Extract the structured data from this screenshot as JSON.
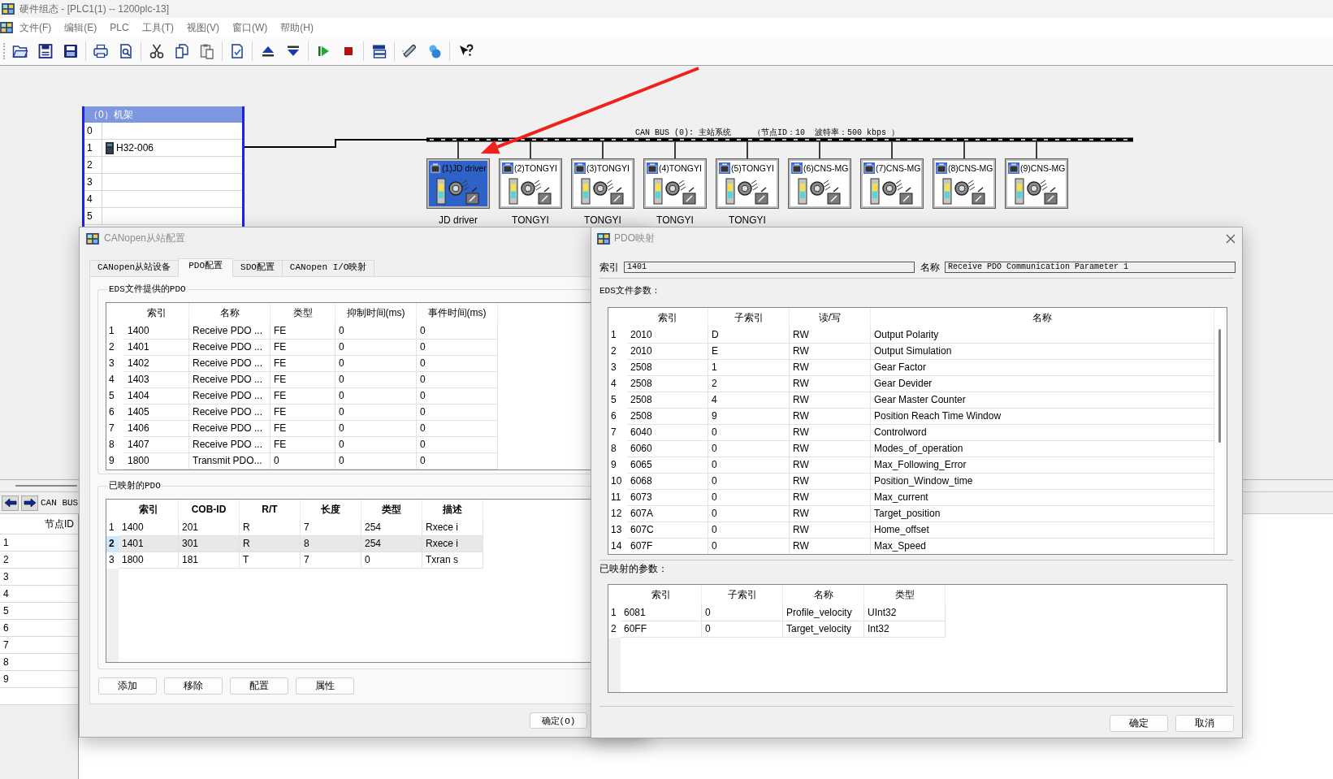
{
  "window": {
    "title": "硬件组态 - [PLC1(1) -- 1200plc-13]"
  },
  "menu": [
    "文件(F)",
    "编辑(E)",
    "PLC",
    "工具(T)",
    "视图(V)",
    "窗口(W)",
    "帮助(H)"
  ],
  "rack": {
    "title": "（0）机架",
    "slots": [
      {
        "slot": "0"
      },
      {
        "slot": "1",
        "module": "H32-006"
      },
      {
        "slot": "2"
      },
      {
        "slot": "3"
      },
      {
        "slot": "4"
      },
      {
        "slot": "5"
      }
    ]
  },
  "bus": {
    "label": "CAN BUS (0): 主站系统",
    "info": "（节点ID：10  波特率：500 kbps ）",
    "nodes": [
      {
        "title": "(1)JD driver",
        "caption": "JD driver",
        "selected": true
      },
      {
        "title": "(2)TONGYI",
        "caption": "TONGYI",
        "selected": false
      },
      {
        "title": "(3)TONGYI",
        "caption": "TONGYI",
        "selected": false
      },
      {
        "title": "(4)TONGYI",
        "caption": "TONGYI",
        "selected": false
      },
      {
        "title": "(5)TONGYI",
        "caption": "TONGYI",
        "selected": false
      },
      {
        "title": "(6)CNS-MG",
        "selected": false
      },
      {
        "title": "(7)CNS-MG",
        "selected": false
      },
      {
        "title": "(8)CNS-MG",
        "selected": false
      },
      {
        "title": "(9)CNS-MG",
        "selected": false
      }
    ]
  },
  "bus_panel": {
    "title": "CAN BUS",
    "column": "节点ID",
    "rows": [
      "1",
      "2",
      "3",
      "4",
      "5",
      "6",
      "7",
      "8",
      "9"
    ]
  },
  "slave_dialog": {
    "title": "CANopen从站配置",
    "tabs": [
      {
        "label": "CANopen从站设备",
        "selected": false
      },
      {
        "label": "PDO配置",
        "selected": true
      },
      {
        "label": "SDO配置",
        "selected": false
      },
      {
        "label": "CANopen I/O映射",
        "selected": false
      }
    ],
    "eds_group": "EDS文件提供的PDO",
    "eds_table": {
      "columns": [
        "索引",
        "名称",
        "类型",
        "抑制时间(ms)",
        "事件时间(ms)"
      ],
      "rows": [
        {
          "num": "1",
          "cells": [
            "1400",
            "Receive PDO ...",
            "FE",
            "0",
            "0"
          ],
          "selected": false
        },
        {
          "num": "2",
          "cells": [
            "1401",
            "Receive PDO ...",
            "FE",
            "0",
            "0"
          ],
          "selected": false
        },
        {
          "num": "3",
          "cells": [
            "1402",
            "Receive PDO ...",
            "FE",
            "0",
            "0"
          ],
          "selected": false
        },
        {
          "num": "4",
          "cells": [
            "1403",
            "Receive PDO ...",
            "FE",
            "0",
            "0"
          ],
          "selected": false
        },
        {
          "num": "5",
          "cells": [
            "1404",
            "Receive PDO ...",
            "FE",
            "0",
            "0"
          ],
          "selected": false
        },
        {
          "num": "6",
          "cells": [
            "1405",
            "Receive PDO ...",
            "FE",
            "0",
            "0"
          ],
          "selected": false
        },
        {
          "num": "7",
          "cells": [
            "1406",
            "Receive PDO ...",
            "FE",
            "0",
            "0"
          ],
          "selected": false
        },
        {
          "num": "8",
          "cells": [
            "1407",
            "Receive PDO ...",
            "FE",
            "0",
            "0"
          ],
          "selected": false
        },
        {
          "num": "9",
          "cells": [
            "1800",
            "Transmit PDO...",
            "0",
            "0",
            "0"
          ],
          "selected": false
        }
      ]
    },
    "mapped_group": "已映射的PDO",
    "mapped_table": {
      "columns": [
        "索引",
        "COB-ID",
        "R/T",
        "长度",
        "类型",
        "描述"
      ],
      "rows": [
        {
          "num": "1",
          "cells": [
            "1400",
            "201",
            "R",
            "7",
            "254",
            "Rxece i"
          ],
          "selected": false
        },
        {
          "num": "2",
          "cells": [
            "1401",
            "301",
            "R",
            "8",
            "254",
            "Rxece i"
          ],
          "selected": true
        },
        {
          "num": "3",
          "cells": [
            "1800",
            "181",
            "T",
            "7",
            "0",
            "Txran s"
          ],
          "selected": false
        }
      ]
    },
    "buttons": [
      "添加",
      "移除",
      "配置",
      "属性"
    ],
    "ok_button": "确定(O)"
  },
  "pdo_dialog": {
    "title": "PDO映射",
    "index_label": "索引",
    "index_value": "1401",
    "name_label": "名称",
    "name_value": "Receive PDO Communication Parameter 1",
    "eds_label": "EDS文件参数：",
    "eds_table": {
      "columns": [
        "索引",
        "子索引",
        "读/写",
        "名称"
      ],
      "rows": [
        {
          "num": "1",
          "cells": [
            "2010",
            "D",
            "RW",
            "Output Polarity"
          ],
          "selected": false
        },
        {
          "num": "2",
          "cells": [
            "2010",
            "E",
            "RW",
            "Output Simulation"
          ],
          "selected": false
        },
        {
          "num": "3",
          "cells": [
            "2508",
            "1",
            "RW",
            "Gear Factor"
          ],
          "selected": false
        },
        {
          "num": "4",
          "cells": [
            "2508",
            "2",
            "RW",
            "Gear Devider"
          ],
          "selected": false
        },
        {
          "num": "5",
          "cells": [
            "2508",
            "4",
            "RW",
            "Gear Master Counter"
          ],
          "selected": false
        },
        {
          "num": "6",
          "cells": [
            "2508",
            "9",
            "RW",
            "Position Reach Time Window"
          ],
          "selected": false
        },
        {
          "num": "7",
          "cells": [
            "6040",
            "0",
            "RW",
            "Controlword"
          ],
          "selected": false
        },
        {
          "num": "8",
          "cells": [
            "6060",
            "0",
            "RW",
            "Modes_of_operation"
          ],
          "selected": false
        },
        {
          "num": "9",
          "cells": [
            "6065",
            "0",
            "RW",
            "Max_Following_Error"
          ],
          "selected": false
        },
        {
          "num": "10",
          "cells": [
            "6068",
            "0",
            "RW",
            "Position_Window_time"
          ],
          "selected": false
        },
        {
          "num": "11",
          "cells": [
            "6073",
            "0",
            "RW",
            "Max_current"
          ],
          "selected": false
        },
        {
          "num": "12",
          "cells": [
            "607A",
            "0",
            "RW",
            "Target_position"
          ],
          "selected": false
        },
        {
          "num": "13",
          "cells": [
            "607C",
            "0",
            "RW",
            "Home_offset"
          ],
          "selected": false
        },
        {
          "num": "14",
          "cells": [
            "607F",
            "0",
            "RW",
            "Max_Speed"
          ],
          "selected": false
        }
      ]
    },
    "mapped_label": "已映射的参数：",
    "mapped_table": {
      "columns": [
        "索引",
        "子索引",
        "名称",
        "类型"
      ],
      "rows": [
        {
          "num": "1",
          "cells": [
            "6081",
            "0",
            "Profile_velocity",
            "UInt32"
          ],
          "selected": false
        },
        {
          "num": "2",
          "cells": [
            "60FF",
            "0",
            "Target_velocity",
            "Int32"
          ],
          "selected": false
        }
      ]
    },
    "buttons": [
      "确定",
      "取消"
    ]
  }
}
